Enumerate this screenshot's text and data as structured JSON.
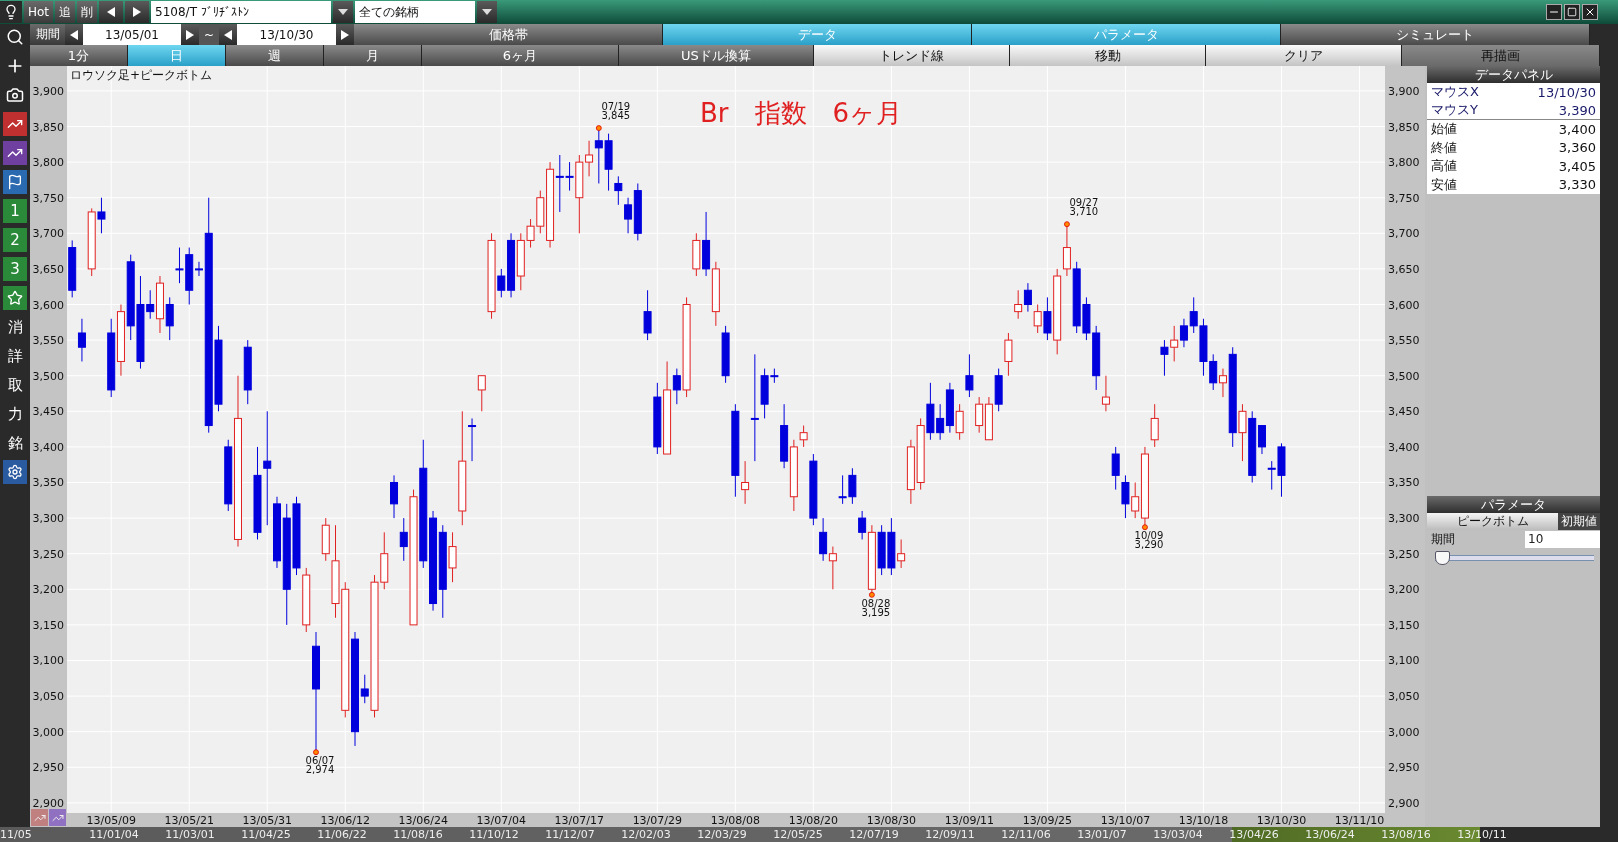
{
  "toolbar": {
    "buttons": [
      {
        "label": "Hot"
      },
      {
        "label": "追"
      },
      {
        "label": "削"
      }
    ],
    "symbol": "5108/T ﾌﾞﾘﾁﾞｽﾄﾝ",
    "universe": "全ての銘柄"
  },
  "period": {
    "label": "期間",
    "start": "13/05/01",
    "separator": "~",
    "end": "13/10/30"
  },
  "mode_tabs": [
    {
      "label": "価格帯",
      "selected": false
    },
    {
      "label": "データ",
      "selected": true
    },
    {
      "label": "パラメータ",
      "selected": true
    },
    {
      "label": "シミュレート",
      "selected": false
    }
  ],
  "interval_tabs": [
    {
      "label": "1分",
      "selected": false
    },
    {
      "label": "日",
      "selected": true
    },
    {
      "label": "週",
      "selected": false
    },
    {
      "label": "月",
      "selected": false
    },
    {
      "label": "6ヶ月",
      "selected": false
    },
    {
      "label": "USドル換算",
      "selected": false
    }
  ],
  "actions": [
    {
      "label": "トレンド線",
      "kind": "light"
    },
    {
      "label": "移動",
      "kind": "light"
    },
    {
      "label": "クリア",
      "kind": "light"
    },
    {
      "label": "再描画",
      "kind": "dark"
    }
  ],
  "side_numbers": [
    "1",
    "2",
    "3"
  ],
  "side_chars": [
    "消",
    "詳",
    "取",
    "力",
    "銘"
  ],
  "chart": {
    "title": "ロウソク足+ピークボトム",
    "overlay": "Br　指数　6ヶ月",
    "right_axis_labels": [
      "3,900",
      "3,850",
      "3,800",
      "3,750",
      "3,700",
      "3,650",
      "3,600",
      "3,550",
      "3,500",
      "3,450",
      "3,400",
      "3,350",
      "3,300",
      "3,250",
      "3,200",
      "3,150",
      "3,100",
      "3,050",
      "3,000",
      "2,950",
      "2,900"
    ],
    "chart_data": {
      "type": "candlestick",
      "grid": true,
      "ylim": [
        2865,
        3935
      ],
      "yticks": [
        {
          "value": 3900,
          "label": "3,900"
        },
        {
          "value": 3850,
          "label": "3,850"
        },
        {
          "value": 3800,
          "label": "3,800"
        },
        {
          "value": 3750,
          "label": "3,750"
        },
        {
          "value": 3700,
          "label": "3,700"
        },
        {
          "value": 3650,
          "label": "3,650"
        },
        {
          "value": 3600,
          "label": "3,600"
        },
        {
          "value": 3550,
          "label": "3,550"
        },
        {
          "value": 3500,
          "label": "3,500"
        },
        {
          "value": 3450,
          "label": "3,450"
        },
        {
          "value": 3400,
          "label": "3,400"
        },
        {
          "value": 3350,
          "label": "3,350"
        },
        {
          "value": 3300,
          "label": "3,300"
        },
        {
          "value": 3250,
          "label": "3,250"
        },
        {
          "value": 3200,
          "label": "3,200"
        },
        {
          "value": 3150,
          "label": "3,150"
        },
        {
          "value": 3100,
          "label": "3,100"
        },
        {
          "value": 3050,
          "label": "3,050"
        },
        {
          "value": 3000,
          "label": "3,000"
        },
        {
          "value": 2950,
          "label": "2,950"
        },
        {
          "value": 2900,
          "label": "2,900"
        }
      ],
      "categories": [
        null,
        null,
        null,
        null,
        "13/05/09",
        null,
        null,
        null,
        null,
        null,
        null,
        null,
        "13/05/21",
        null,
        null,
        null,
        null,
        null,
        null,
        null,
        "13/05/31",
        null,
        null,
        null,
        null,
        null,
        null,
        null,
        "13/06/12",
        null,
        null,
        null,
        null,
        null,
        null,
        null,
        "13/06/24",
        null,
        null,
        null,
        null,
        null,
        null,
        null,
        "13/07/04",
        null,
        null,
        null,
        null,
        null,
        null,
        null,
        "13/07/17",
        null,
        null,
        null,
        null,
        null,
        null,
        null,
        "13/07/29",
        null,
        null,
        null,
        null,
        null,
        null,
        null,
        "13/08/08",
        null,
        null,
        null,
        null,
        null,
        null,
        null,
        "13/08/20",
        null,
        null,
        null,
        null,
        null,
        null,
        null,
        "13/08/30",
        null,
        null,
        null,
        null,
        null,
        null,
        null,
        "13/09/11",
        null,
        null,
        null,
        null,
        null,
        null,
        null,
        "13/09/25",
        null,
        null,
        null,
        null,
        null,
        null,
        null,
        "13/10/07",
        null,
        null,
        null,
        null,
        null,
        null,
        null,
        "13/10/18",
        null,
        null,
        null,
        null,
        null,
        null,
        null,
        "13/10/30",
        null,
        null,
        null,
        null,
        null,
        null,
        null,
        "13/11/10"
      ],
      "ohlc": [
        [
          3680,
          3690,
          3610,
          3620
        ],
        [
          3560,
          3580,
          3520,
          3540
        ],
        [
          3650,
          3735,
          3640,
          3730
        ],
        [
          3730,
          3750,
          3700,
          3720
        ],
        [
          3560,
          3580,
          3470,
          3480
        ],
        [
          3520,
          3600,
          3500,
          3590
        ],
        [
          3660,
          3670,
          3550,
          3570
        ],
        [
          3600,
          3640,
          3510,
          3520
        ],
        [
          3600,
          3620,
          3580,
          3590
        ],
        [
          3580,
          3640,
          3560,
          3630
        ],
        [
          3600,
          3610,
          3550,
          3570
        ],
        [
          3650,
          3680,
          3630,
          3650
        ],
        [
          3670,
          3680,
          3600,
          3620
        ],
        [
          3650,
          3660,
          3640,
          3650
        ],
        [
          3700,
          3750,
          3420,
          3430
        ],
        [
          3550,
          3570,
          3450,
          3460
        ],
        [
          3400,
          3410,
          3310,
          3320
        ],
        [
          3270,
          3500,
          3260,
          3440
        ],
        [
          3540,
          3550,
          3460,
          3480
        ],
        [
          3360,
          3400,
          3270,
          3280
        ],
        [
          3380,
          3450,
          3290,
          3370
        ],
        [
          3320,
          3330,
          3230,
          3240
        ],
        [
          3300,
          3320,
          3150,
          3200
        ],
        [
          3320,
          3330,
          3220,
          3230
        ],
        [
          3150,
          3230,
          3140,
          3220
        ],
        [
          3120,
          3140,
          2974,
          3060
        ],
        [
          3250,
          3300,
          3240,
          3290
        ],
        [
          3180,
          3290,
          3160,
          3240
        ],
        [
          3030,
          3210,
          3020,
          3200
        ],
        [
          3130,
          3140,
          2980,
          3000
        ],
        [
          3060,
          3080,
          3040,
          3050
        ],
        [
          3030,
          3220,
          3020,
          3210
        ],
        [
          3210,
          3280,
          3200,
          3250
        ],
        [
          3350,
          3360,
          3300,
          3320
        ],
        [
          3280,
          3300,
          3240,
          3260
        ],
        [
          3150,
          3340,
          3150,
          3330
        ],
        [
          3370,
          3410,
          3230,
          3240
        ],
        [
          3300,
          3310,
          3170,
          3180
        ],
        [
          3280,
          3290,
          3160,
          3200
        ],
        [
          3230,
          3280,
          3210,
          3260
        ],
        [
          3310,
          3450,
          3290,
          3380
        ],
        [
          3430,
          3440,
          3380,
          3430
        ],
        [
          3480,
          3500,
          3450,
          3500
        ],
        [
          3590,
          3700,
          3580,
          3690
        ],
        [
          3640,
          3650,
          3610,
          3620
        ],
        [
          3690,
          3700,
          3610,
          3620
        ],
        [
          3640,
          3700,
          3620,
          3690
        ],
        [
          3690,
          3720,
          3680,
          3710
        ],
        [
          3710,
          3760,
          3700,
          3750
        ],
        [
          3690,
          3800,
          3680,
          3790
        ],
        [
          3780,
          3810,
          3730,
          3780
        ],
        [
          3780,
          3800,
          3760,
          3780
        ],
        [
          3750,
          3810,
          3700,
          3800
        ],
        [
          3800,
          3830,
          3780,
          3810
        ],
        [
          3830,
          3845,
          3770,
          3820
        ],
        [
          3830,
          3840,
          3760,
          3790
        ],
        [
          3770,
          3780,
          3740,
          3760
        ],
        [
          3740,
          3750,
          3700,
          3720
        ],
        [
          3760,
          3770,
          3690,
          3700
        ],
        [
          3590,
          3620,
          3550,
          3560
        ],
        [
          3470,
          3490,
          3390,
          3400
        ],
        [
          3390,
          3520,
          3390,
          3480
        ],
        [
          3500,
          3510,
          3460,
          3480
        ],
        [
          3480,
          3610,
          3470,
          3600
        ],
        [
          3650,
          3700,
          3640,
          3690
        ],
        [
          3690,
          3730,
          3640,
          3650
        ],
        [
          3590,
          3660,
          3570,
          3650
        ],
        [
          3560,
          3570,
          3490,
          3500
        ],
        [
          3450,
          3460,
          3330,
          3360
        ],
        [
          3340,
          3380,
          3320,
          3350
        ],
        [
          3440,
          3530,
          3380,
          3440
        ],
        [
          3500,
          3510,
          3440,
          3460
        ],
        [
          3500,
          3510,
          3490,
          3500
        ],
        [
          3430,
          3460,
          3370,
          3380
        ],
        [
          3330,
          3410,
          3310,
          3400
        ],
        [
          3410,
          3430,
          3400,
          3420
        ],
        [
          3380,
          3390,
          3290,
          3300
        ],
        [
          3280,
          3300,
          3240,
          3250
        ],
        [
          3240,
          3260,
          3200,
          3250
        ],
        [
          3330,
          3360,
          3320,
          3330
        ],
        [
          3360,
          3370,
          3320,
          3330
        ],
        [
          3300,
          3310,
          3270,
          3280
        ],
        [
          3200,
          3290,
          3195,
          3280
        ],
        [
          3280,
          3290,
          3220,
          3230
        ],
        [
          3280,
          3300,
          3220,
          3230
        ],
        [
          3240,
          3270,
          3230,
          3250
        ],
        [
          3340,
          3410,
          3320,
          3400
        ],
        [
          3350,
          3440,
          3340,
          3430
        ],
        [
          3460,
          3490,
          3410,
          3420
        ],
        [
          3440,
          3460,
          3410,
          3420
        ],
        [
          3480,
          3490,
          3420,
          3430
        ],
        [
          3420,
          3460,
          3410,
          3450
        ],
        [
          3500,
          3530,
          3470,
          3480
        ],
        [
          3430,
          3470,
          3420,
          3460
        ],
        [
          3410,
          3470,
          3410,
          3460
        ],
        [
          3500,
          3510,
          3450,
          3460
        ],
        [
          3520,
          3560,
          3500,
          3550
        ],
        [
          3590,
          3620,
          3580,
          3600
        ],
        [
          3620,
          3630,
          3590,
          3600
        ],
        [
          3570,
          3600,
          3560,
          3590
        ],
        [
          3590,
          3610,
          3550,
          3560
        ],
        [
          3550,
          3650,
          3530,
          3640
        ],
        [
          3650,
          3710,
          3640,
          3680
        ],
        [
          3650,
          3660,
          3560,
          3570
        ],
        [
          3600,
          3610,
          3550,
          3560
        ],
        [
          3560,
          3570,
          3480,
          3500
        ],
        [
          3460,
          3500,
          3450,
          3470
        ],
        [
          3390,
          3400,
          3340,
          3360
        ],
        [
          3350,
          3360,
          3300,
          3320
        ],
        [
          3310,
          3350,
          3300,
          3330
        ],
        [
          3300,
          3400,
          3290,
          3390
        ],
        [
          3410,
          3460,
          3400,
          3440
        ],
        [
          3540,
          3550,
          3500,
          3530
        ],
        [
          3540,
          3570,
          3520,
          3550
        ],
        [
          3570,
          3580,
          3540,
          3550
        ],
        [
          3590,
          3610,
          3560,
          3570
        ],
        [
          3570,
          3580,
          3500,
          3520
        ],
        [
          3520,
          3530,
          3480,
          3490
        ],
        [
          3490,
          3510,
          3470,
          3500
        ],
        [
          3530,
          3540,
          3400,
          3420
        ],
        [
          3420,
          3460,
          3380,
          3450
        ],
        [
          3440,
          3450,
          3350,
          3360
        ],
        [
          3430,
          3430,
          3390,
          3400
        ],
        [
          3370,
          3380,
          3340,
          3370
        ],
        [
          3400,
          3405,
          3330,
          3360
        ],
        null,
        null,
        null,
        null,
        null,
        null,
        null,
        null
      ],
      "annotations": [
        "07/19",
        "3,845",
        "06/07",
        "2,974",
        "08/28",
        "3,195",
        "09/27",
        "3,710",
        "10/09",
        "3,290"
      ]
    }
  },
  "data_panel": {
    "title": "データパネル",
    "rows": [
      {
        "label": "マウスX",
        "value": "13/10/30",
        "kind": "mouse"
      },
      {
        "label": "マウスY",
        "value": "3,390",
        "kind": "mouse"
      },
      {
        "label": "始値",
        "value": "3,400",
        "kind": "price"
      },
      {
        "label": "終値",
        "value": "3,360",
        "kind": "price"
      },
      {
        "label": "高値",
        "value": "3,405",
        "kind": "price"
      },
      {
        "label": "安値",
        "value": "3,330",
        "kind": "price"
      }
    ]
  },
  "parameters": {
    "title": "パラメータ",
    "indicator": "ピークボトム",
    "reset": "初期値",
    "field": {
      "label": "期間",
      "value": "10"
    },
    "slider": {
      "level": 0.0
    }
  },
  "navigator": {
    "dates": [
      "11/05",
      "11/01/04",
      "11/03/01",
      "11/04/25",
      "11/06/22",
      "11/08/16",
      "11/10/12",
      "11/12/07",
      "12/02/03",
      "12/03/29",
      "12/05/25",
      "12/07/19",
      "12/09/11",
      "12/11/06",
      "13/01/07",
      "13/03/04",
      "13/04/26",
      "13/06/24",
      "13/08/16",
      "13/10/11"
    ]
  }
}
